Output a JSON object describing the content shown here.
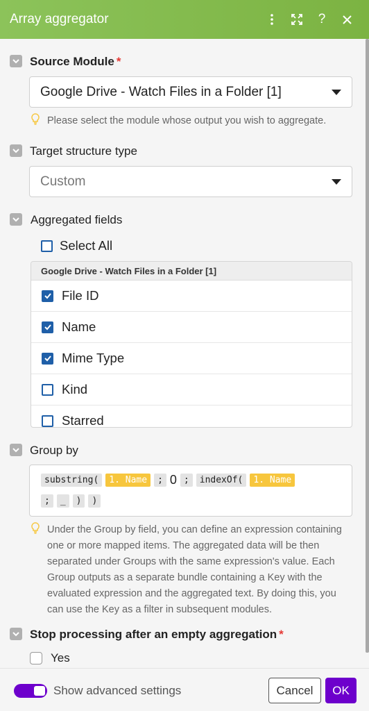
{
  "header": {
    "title": "Array aggregator",
    "icons": [
      "more-vertical-icon",
      "expand-icon",
      "help-icon",
      "close-icon"
    ]
  },
  "source_module": {
    "label": "Source Module",
    "required_mark": "*",
    "value": "Google Drive - Watch Files in a Folder [1]",
    "hint": "Please select the module whose output you wish to aggregate."
  },
  "target_structure": {
    "label": "Target structure type",
    "value": "Custom"
  },
  "aggregated_fields": {
    "label": "Aggregated fields",
    "select_all": "Select All",
    "group_title": "Google Drive - Watch Files in a Folder [1]",
    "items": [
      {
        "label": "File ID",
        "checked": true
      },
      {
        "label": "Name",
        "checked": true
      },
      {
        "label": "Mime Type",
        "checked": true
      },
      {
        "label": "Kind",
        "checked": false
      },
      {
        "label": "Starred",
        "checked": false
      }
    ]
  },
  "group_by": {
    "label": "Group by",
    "tokens_line1": [
      "substring(",
      "1. Name",
      ";",
      "0",
      ";",
      "indexOf(",
      "1. Name"
    ],
    "tokens_line2": [
      ";",
      "_",
      ")",
      ")"
    ],
    "hint": "Under the Group by field, you can define an expression containing one or more mapped items. The aggregated data will be then separated under Groups with the same expression's value. Each Group outputs as a separate bundle containing a Key with the evaluated expression and the aggregated text. By doing this, you can use the Key as a filter in subsequent modules."
  },
  "stop_processing": {
    "label": "Stop processing after an empty aggregation",
    "required_mark": "*",
    "option": "Yes"
  },
  "footer": {
    "advanced_label": "Show advanced settings",
    "advanced_on": true,
    "cancel": "Cancel",
    "ok": "OK"
  },
  "colors": {
    "header": "#7cb342",
    "accent": "#6d00cc",
    "checkbox": "#1f5fa8",
    "token_mapped": "#f7c63d"
  }
}
